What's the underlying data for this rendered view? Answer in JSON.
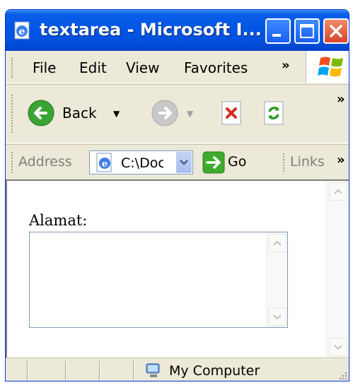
{
  "window": {
    "title": "textarea - Microsoft I..."
  },
  "menu": {
    "items": [
      "File",
      "Edit",
      "View",
      "Favorites"
    ],
    "overflow": "»"
  },
  "toolbar": {
    "back_label": "Back",
    "overflow": "»"
  },
  "address": {
    "label": "Address",
    "value": "C:\\Doc",
    "go_label": "Go",
    "links_label": "Links",
    "overflow": "»"
  },
  "page": {
    "field_label": "Alamat:",
    "textarea_value": ""
  },
  "status": {
    "zone": "My Computer"
  },
  "colors": {
    "titlebar": "#0054e3",
    "chrome": "#ece9d8",
    "close_button": "#d8442a"
  }
}
